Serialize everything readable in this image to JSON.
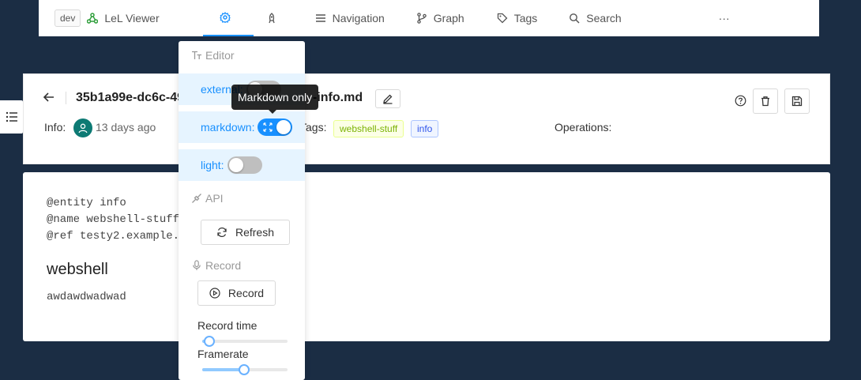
{
  "topnav": {
    "env_tag": "dev",
    "app_name": "LeL Viewer",
    "items": [
      "Navigation",
      "Graph",
      "Tags",
      "Search"
    ],
    "more": "···"
  },
  "header": {
    "title_left": "35b1a99e-dc6c-49",
    "title_right": "-info.md",
    "info_label": "Info",
    "info_time": "13 days ago",
    "tags_label": "Tags",
    "tags": [
      "webshell-stuff",
      "info"
    ],
    "operations_label": "Operations"
  },
  "content": {
    "lines": [
      "@entity info",
      "@name webshell-stuff",
      "@ref testy2.example."
    ],
    "heading": "webshell",
    "body": "awdawdwadwad"
  },
  "settings_menu": {
    "editor_title": "Editor",
    "options": [
      {
        "label": "external:",
        "on": false
      },
      {
        "label": "markdown:",
        "on": true
      },
      {
        "label": "light:",
        "on": false
      }
    ],
    "api_title": "API",
    "refresh_label": "Refresh",
    "record_title": "Record",
    "record_button": "Record",
    "record_time_label": "Record time",
    "record_time_value": 0.08,
    "framerate_label": "Framerate",
    "framerate_value": 0.49
  },
  "tooltip": "Markdown only",
  "colors": {
    "background": "#1b2d44",
    "accent": "#1890ff",
    "avatar": "#0d7a74"
  }
}
